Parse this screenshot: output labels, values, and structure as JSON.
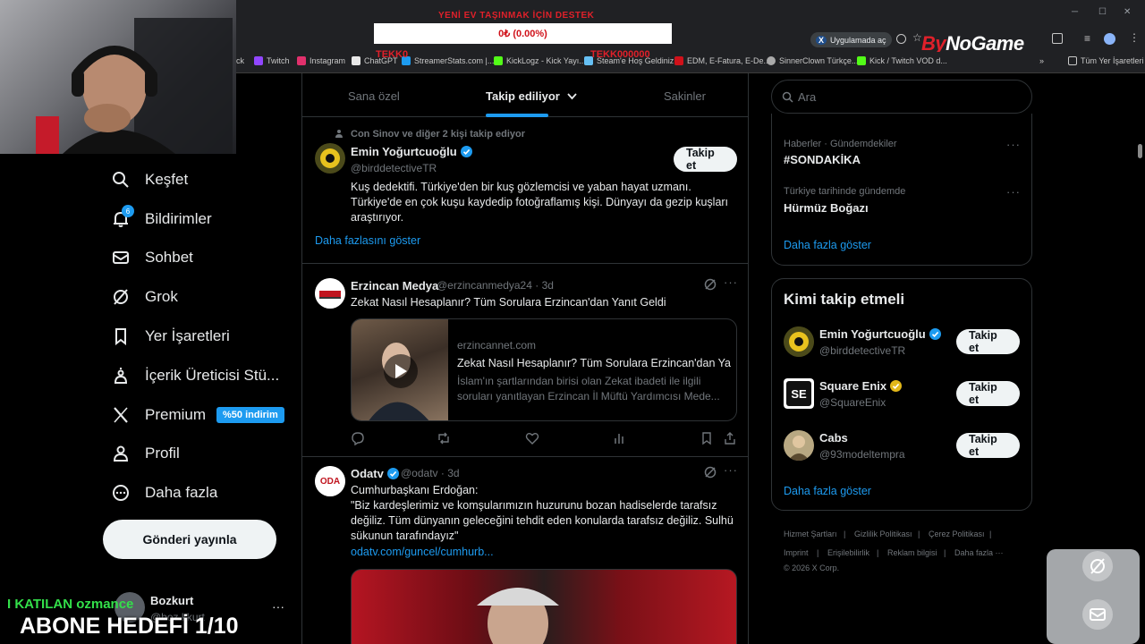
{
  "overlay": {
    "top_text": "YENİ EV TAŞINMAK İÇİN DESTEK",
    "donation_amount": "0₺ (0.00%)",
    "mid_left": "TEKK0",
    "mid_right": "TEKK000000",
    "joined_text": "I KATILAN ozmance",
    "sub_goal": "ABONE HEDEFİ 1/10",
    "brand": {
      "part1": "By",
      "part2": "NoGame"
    }
  },
  "browser": {
    "open_in_app": "Uygulamada aç",
    "bookmarks": [
      {
        "label": "ck",
        "color": "#9146ff"
      },
      {
        "label": "Twitch",
        "color": "#9146ff"
      },
      {
        "label": "Instagram",
        "color": "#e1306c"
      },
      {
        "label": "ChatGPT",
        "color": "#ffffff"
      },
      {
        "label": "StreamerStats.com |...",
        "color": "#1d9bf0"
      },
      {
        "label": "KickLogz - Kick Yayı...",
        "color": "#53fc18"
      },
      {
        "label": "Steam'e Hoş Geldiniz",
        "color": "#66c0f4"
      },
      {
        "label": "EDM, E-Fatura, E-De...",
        "color": "#d0111a"
      },
      {
        "label": "SinnerClown Türkçe...",
        "color": "#aaaaaa"
      },
      {
        "label": "Kick / Twitch VOD d...",
        "color": "#53fc18"
      }
    ],
    "all_bookmarks": "Tüm Yer İşaretleri"
  },
  "nav": {
    "items": [
      {
        "label": "Keşfet",
        "icon": "search-icon"
      },
      {
        "label": "Bildirimler",
        "icon": "bell-icon"
      },
      {
        "label": "Sohbet",
        "icon": "mail-icon"
      },
      {
        "label": "Grok",
        "icon": "grok-icon"
      },
      {
        "label": "Yer İşaretleri",
        "icon": "bookmark-icon"
      },
      {
        "label": "İçerik Üreticisi Stü...",
        "icon": "creator-icon"
      },
      {
        "label": "Premium",
        "icon": "x-logo-icon"
      },
      {
        "label": "Profil",
        "icon": "person-icon"
      },
      {
        "label": "Daha fazla",
        "icon": "more-circle-icon"
      }
    ],
    "notifications_count": "6",
    "premium_badge": "%50 indirim",
    "post_button": "Gönderi yayınla",
    "account": {
      "name": "Bozkurt",
      "handle": "@boz.kkurt"
    }
  },
  "tabs": [
    {
      "label": "Sana özel",
      "active": false
    },
    {
      "label": "Takip ediliyor",
      "active": true
    },
    {
      "label": "Sakinler",
      "active": false
    }
  ],
  "suggested": {
    "context": "Con Sinov ve diğer 2 kişi takip ediyor",
    "name": "Emin Yoğurtcuoğlu",
    "handle": "@birddetectiveTR",
    "follow": "Takip et",
    "bio": "Kuş dedektifi. Türkiye'den bir kuş gözlemcisi ve yaban hayat uzmanı. Türkiye'de en çok kuşu kaydedip fotoğraflamış kişi. Dünyayı da gezip kuşları araştırıyor.",
    "show_more": "Daha fazlasını göster"
  },
  "posts": [
    {
      "name": "Erzincan Medya",
      "handle": "@erzincanmedya24",
      "time": "· 3d",
      "text": "Zekat Nasıl Hesaplanır? Tüm Sorulara Erzincan'dan Yanıt Geldi",
      "card": {
        "domain": "erzincannet.com",
        "title": "Zekat Nasıl Hesaplanır? Tüm Sorulara Erzincan'dan Ya...",
        "desc": "İslam'ın şartlarından birisi olan Zekat ibadeti ile ilgili soruları yanıtlayan Erzincan İl Müftü Yardımcısı Mede..."
      }
    },
    {
      "name": "Odatv",
      "handle": "@odatv",
      "time": "· 3d",
      "text": "Cumhurbaşkanı Erdoğan:\n\"Biz kardeşlerimiz ve komşularımızın huzurunu bozan hadiselerde tarafsız değiliz. Tüm dünyanın geleceğini tehdit eden konularda tarafsız değiliz. Sulhü sükunun tarafındayız\"",
      "link": "odatv.com/guncel/cumhurb..."
    }
  ],
  "search": {
    "placeholder": "Ara"
  },
  "trends": [
    {
      "category": "Haberler · Gündemdekiler",
      "name": "#SONDAKİKA"
    },
    {
      "category": "Türkiye tarihinde gündemde",
      "name": "Hürmüz Boğazı"
    }
  ],
  "trends_show_more": "Daha fazla göster",
  "who_to_follow": {
    "title": "Kimi takip etmeli",
    "items": [
      {
        "name": "Emin Yoğurtcuoğlu",
        "handle": "@birddetectiveTR",
        "follow": "Takip et"
      },
      {
        "name": "Square Enix",
        "handle": "@SquareEnix",
        "follow": "Takip et"
      },
      {
        "name": "Cabs",
        "handle": "@93modeltempra",
        "follow": "Takip et"
      }
    ],
    "show_more": "Daha fazla göster"
  },
  "footer": {
    "links": [
      "Hizmet Şartları",
      "Gizlilik Politikası",
      "Çerez Politikası",
      "Imprint",
      "Erişilebilirlik",
      "Reklam bilgisi",
      "Daha fazla ···"
    ],
    "copyright": "© 2026 X Corp."
  },
  "colors": {
    "accent": "#1d9bf0",
    "background": "#000000",
    "border": "#2f3336",
    "muted": "#71767b"
  }
}
